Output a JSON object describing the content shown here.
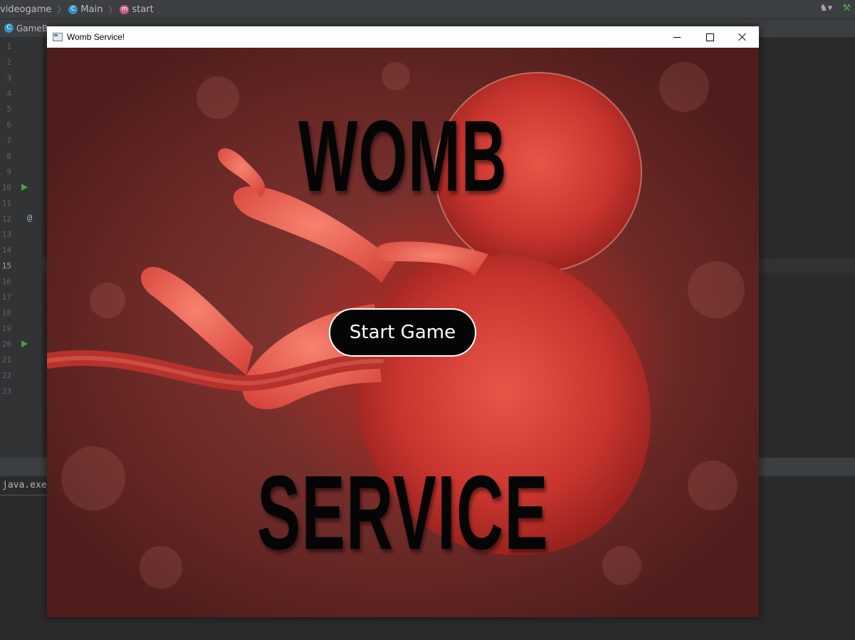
{
  "ide": {
    "breadcrumbs": [
      {
        "label": "videogame",
        "icon": ""
      },
      {
        "label": "Main",
        "icon": "C"
      },
      {
        "label": "start",
        "icon": "m"
      }
    ],
    "tabs": [
      {
        "label": "GameBo",
        "icon": "C"
      }
    ],
    "line_numbers": [
      "1",
      "2",
      "3",
      "4",
      "5",
      "6",
      "7",
      "8",
      "9",
      "10",
      "11",
      "12",
      "13",
      "14",
      "15",
      "16",
      "17",
      "18",
      "19",
      "20",
      "21",
      "22",
      "23"
    ],
    "active_line": "15",
    "gutter_at_symbol": "@",
    "console_text": "java.exe"
  },
  "app": {
    "window_title": "Womb Service!",
    "title_top": "WOMB",
    "title_bottom": "SERVICE",
    "start_button_label": "Start Game",
    "colors": {
      "title_text": "#050505",
      "button_bg": "#050505",
      "button_text": "#ffffff",
      "background": "#7a2e2a",
      "fetus": "#d9433a"
    }
  }
}
